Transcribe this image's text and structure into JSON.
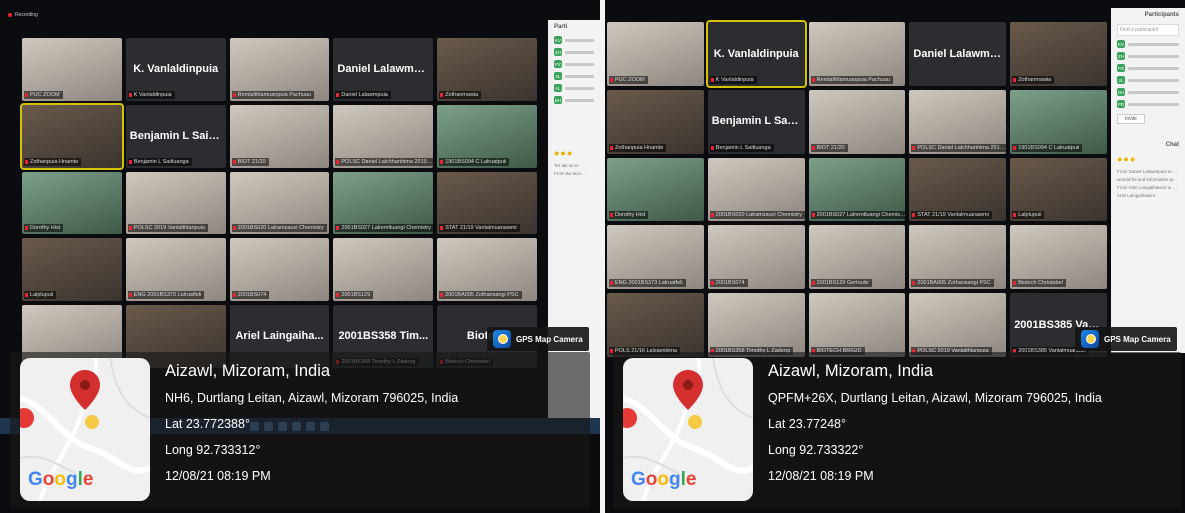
{
  "left": {
    "recording_label": "Recording",
    "tiles": [
      {
        "kind": "video",
        "tone": "light",
        "label": "PUC ZOOM"
      },
      {
        "kind": "name",
        "name": "K. Vanlaldinpuia",
        "label": "K Vanlaldinpuia"
      },
      {
        "kind": "video",
        "tone": "light",
        "label": "Remlalthlamuanpuia Pachuau"
      },
      {
        "kind": "name",
        "name": "Daniel Lalawmp...",
        "label": "Daniel Lalawmpuia"
      },
      {
        "kind": "video",
        "tone": "dark",
        "label": "Zothanmawia"
      },
      {
        "kind": "video",
        "tone": "dark",
        "active": true,
        "label": "Zothanpuia Hnamte"
      },
      {
        "kind": "name",
        "name": "Benjamin L Saitl...",
        "label": "Benjamin L Saitluanga"
      },
      {
        "kind": "video",
        "tone": "light",
        "label": "BIOT 21/20"
      },
      {
        "kind": "video",
        "tone": "light",
        "label": "POLSC Daniel Lalchhanhima 2019BA"
      },
      {
        "kind": "video",
        "tone": "green",
        "label": "1901BS094 C Lalruatpuii"
      },
      {
        "kind": "video",
        "tone": "green",
        "label": "Dorothy Hist"
      },
      {
        "kind": "video",
        "tone": "light",
        "label": "POLSC 2019 Vanlalthlanpuia"
      },
      {
        "kind": "video",
        "tone": "light",
        "label": "2001BS020 Lalramzauvi Chemistry"
      },
      {
        "kind": "video",
        "tone": "green",
        "label": "2001BS027 Lalremtluangi Chemistry"
      },
      {
        "kind": "video",
        "tone": "dark",
        "label": "STAT 21/19 Vanlalmuanawmi"
      },
      {
        "kind": "video",
        "tone": "dark",
        "label": "Lalplupuii"
      },
      {
        "kind": "video",
        "tone": "light",
        "label": "ENG 2001BS373 Lalruatfeli"
      },
      {
        "kind": "video",
        "tone": "light",
        "label": "2001BS074"
      },
      {
        "kind": "video",
        "tone": "light",
        "label": "2001BS129"
      },
      {
        "kind": "video",
        "tone": "light",
        "label": "2001BA005 Zothansangi PSC"
      },
      {
        "kind": "video",
        "tone": "light",
        "label": ""
      },
      {
        "kind": "video",
        "tone": "dark",
        "label": ""
      },
      {
        "kind": "name",
        "name": "Ariel Laingaiha...",
        "label": ""
      },
      {
        "kind": "name",
        "name": "2001BS358 Tim...",
        "label": "2001BS358 Timothy L Zadeng"
      },
      {
        "kind": "name",
        "name": "Biotech",
        "label": "Biotech Christabel"
      }
    ],
    "panel_title": "Parti",
    "panel_initials": [
      "KV",
      "ZH",
      "PZ",
      "2L",
      "AL",
      "DH"
    ],
    "chat_snippets": [
      "Tor tak an ni",
      "From Bu tech..."
    ],
    "gps_label": "GPS Map Camera",
    "location": {
      "city": "Aizawl, Mizoram, India",
      "address": "NH6, Durtlang Leitan, Aizawl, Mizoram 796025, India",
      "lat": "Lat 23.772388°",
      "long": "Long 92.733312°",
      "datetime": "12/08/21 08:19 PM",
      "map_brand": "Google"
    }
  },
  "right": {
    "tiles": [
      {
        "kind": "video",
        "tone": "light",
        "label": "PUC ZOOM"
      },
      {
        "kind": "name",
        "active": true,
        "name": "K. Vanlaldinpuia",
        "label": "K Vanlaldinpuia"
      },
      {
        "kind": "video",
        "tone": "light",
        "label": "Remlalthlamuanpuia Pachuau"
      },
      {
        "kind": "name",
        "name": "Daniel Lalawmpuia",
        "label": ""
      },
      {
        "kind": "video",
        "tone": "dark",
        "label": "Zothanmawia"
      },
      {
        "kind": "video",
        "tone": "dark",
        "label": "Zothanpuia Hnamte"
      },
      {
        "kind": "name",
        "name": "Benjamin L Saitl...",
        "label": "Benjamin L Saitluanga"
      },
      {
        "kind": "video",
        "tone": "light",
        "label": "BIOT 21/20"
      },
      {
        "kind": "video",
        "tone": "light",
        "label": "POLSC Daniel Lalchhanhima 2019BA"
      },
      {
        "kind": "video",
        "tone": "green",
        "label": "1901BS094 C Lalruatpuii"
      },
      {
        "kind": "video",
        "tone": "green",
        "label": "Dorothy Hist"
      },
      {
        "kind": "video",
        "tone": "light",
        "label": "2001BS020 Lalramzauvi Chemistry"
      },
      {
        "kind": "video",
        "tone": "green",
        "label": "2001BS027 Lalremtluangi Chemistry"
      },
      {
        "kind": "video",
        "tone": "dark",
        "label": "STAT 21/19 Vanlalmuanawmi"
      },
      {
        "kind": "video",
        "tone": "dark",
        "label": "Lalplupuii"
      },
      {
        "kind": "video",
        "tone": "light",
        "label": "ENG 2001BS373 Lalruatfeli"
      },
      {
        "kind": "video",
        "tone": "light",
        "label": "2001BS074"
      },
      {
        "kind": "video",
        "tone": "light",
        "label": "2001BS129 Gertrude"
      },
      {
        "kind": "video",
        "tone": "light",
        "label": "2001BA005 Zothansangi PSC"
      },
      {
        "kind": "video",
        "tone": "light",
        "label": "Biotech Christabel"
      },
      {
        "kind": "video",
        "tone": "dark",
        "label": "POLS 21/16 Lalsiamkima"
      },
      {
        "kind": "video",
        "tone": "light",
        "label": "2001BS358 Timothy L Zadeng"
      },
      {
        "kind": "video",
        "tone": "light",
        "label": "BIOTECH BRIGID"
      },
      {
        "kind": "video",
        "tone": "light",
        "label": "POLSC 2019 Vanlalthlanpuia"
      },
      {
        "kind": "name",
        "name": "2001BS385 Vanl...",
        "label": "2001BS385 Vanlalmuanpuii"
      }
    ],
    "panel_title": "Participants",
    "panel_search": "Find a participant",
    "panel_initials": [
      "KV",
      "ZH",
      "PZ",
      "2L",
      "DH",
      "PD"
    ],
    "panel_invite": "Invite",
    "chat_title": "Chat",
    "chat_snippets": [
      "From Daniel Lalawmpuia to Everyone",
      "wonderful and informative presentation Sir, tp",
      "From Ariel Laingaihawmi to Everyone",
      "Ariel Laingaihawmi"
    ],
    "gps_label": "GPS Map Camera",
    "location": {
      "city": "Aizawl, Mizoram, India",
      "address": "QPFM+26X, Durtlang Leitan, Aizawl, Mizoram 796025, India",
      "lat": "Lat 23.77248°",
      "long": "Long 92.733322°",
      "datetime": "12/08/21 08:19 PM",
      "map_brand": "Google"
    }
  },
  "colors": {
    "accent_red": "#E53935",
    "pin_red": "#D32F2F",
    "highlight": "#D4C400",
    "overlay": "#191919"
  }
}
